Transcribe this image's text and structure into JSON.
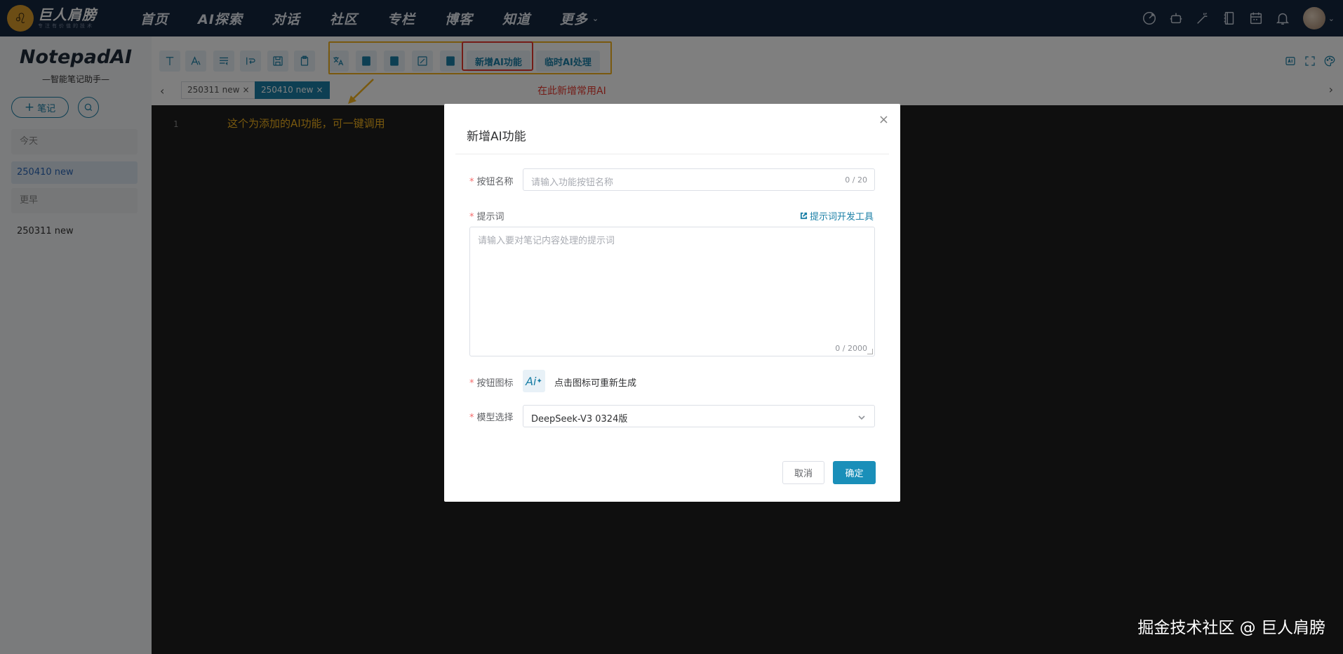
{
  "topnav": {
    "logo_name": "巨人肩膀",
    "logo_sub": "专注有价值的技术",
    "items": [
      "首页",
      "AI探索",
      "对话",
      "社区",
      "专栏",
      "博客",
      "知道",
      "更多"
    ]
  },
  "sidebar": {
    "app_title": "NotepadAI",
    "app_subtitle": "—智能笔记助手—",
    "new_note_label": "笔记",
    "groups": [
      {
        "label": "今天",
        "notes": [
          "250410 new"
        ]
      },
      {
        "label": "更早",
        "notes": [
          "250311 new"
        ]
      }
    ]
  },
  "toolbar": {
    "add_ai_label": "新增AI功能",
    "temp_ai_label": "临时AI处理"
  },
  "tabs": [
    {
      "label": "250311 new",
      "active": false
    },
    {
      "label": "250410 new",
      "active": true
    }
  ],
  "annotations": {
    "red_note": "在此新增常用AI",
    "yellow_note": "这个为添加的AI功能，可一键调用"
  },
  "editor": {
    "line_number": "1"
  },
  "dialog": {
    "title": "新增AI功能",
    "name_label": "按钮名称",
    "name_placeholder": "请输入功能按钮名称",
    "name_count": "0 / 20",
    "prompt_label": "提示词",
    "prompt_link": "提示词开发工具",
    "prompt_placeholder": "请输入要对笔记内容处理的提示词",
    "prompt_count": "0 / 2000",
    "icon_label": "按钮图标",
    "icon_text": "Ai",
    "regen_text": "点击图标可重新生成",
    "model_label": "模型选择",
    "model_value": "DeepSeek-V3 0324版",
    "cancel_label": "取消",
    "ok_label": "确定"
  },
  "watermark": "掘金技术社区 @ 巨人肩膀",
  "colors": {
    "nav_bg": "#15273f",
    "accent": "#1a7fa6",
    "highlight_yellow": "#f2b21e",
    "highlight_red": "#e8392f",
    "editor_bg": "#1e1e1e"
  }
}
